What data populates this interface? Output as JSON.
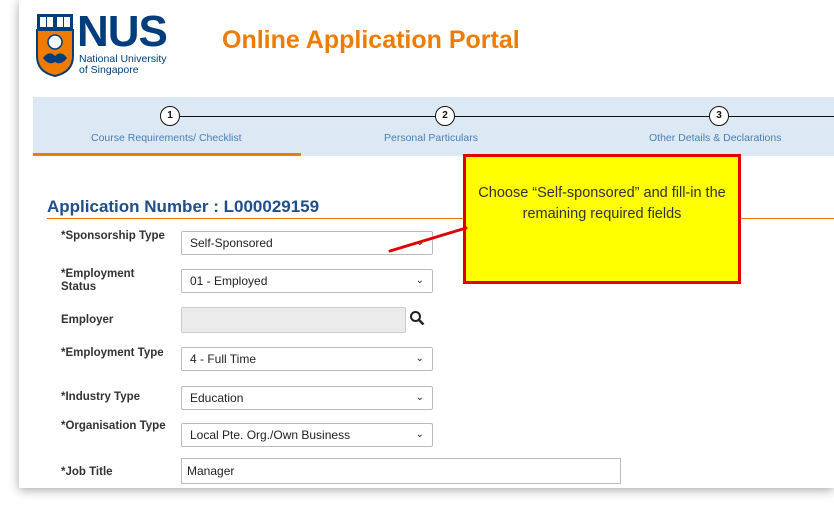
{
  "header": {
    "logo_word": "NUS",
    "logo_sub_1": "National University",
    "logo_sub_2": "of Singapore",
    "portal_title": "Online Application Portal"
  },
  "steps": [
    {
      "number": "1",
      "label": "Course Requirements/ Checklist"
    },
    {
      "number": "2",
      "label": "Personal Particulars"
    },
    {
      "number": "3",
      "label": "Other Details & Declarations"
    }
  ],
  "application": {
    "number_text": "Application Number : L000029159"
  },
  "form": {
    "sponsorship_label": "*Sponsorship Type",
    "sponsorship_value": "Self-Sponsored",
    "employment_status_label": "*Employment Status",
    "employment_status_value": "01 - Employed",
    "employer_label": "Employer",
    "employer_value": "",
    "employment_type_label": "*Employment Type",
    "employment_type_value": "4 - Full Time",
    "industry_label": "*Industry Type",
    "industry_value": "Education",
    "organisation_label": "*Organisation Type",
    "organisation_value": "Local Pte. Org./Own Business",
    "job_title_label": "*Job Title",
    "job_title_value": "Manager"
  },
  "callout": {
    "text": "Choose “Self-sponsored” and fill-in the remaining required fields"
  },
  "colors": {
    "accent_orange": "#ef7c00",
    "nus_blue": "#003d7c",
    "step_bar": "#dce9f5",
    "callout_fill": "#ffff00",
    "callout_border": "#e00000"
  },
  "icons": {
    "search": "search-icon",
    "dropdown": "chevron-down-icon"
  }
}
